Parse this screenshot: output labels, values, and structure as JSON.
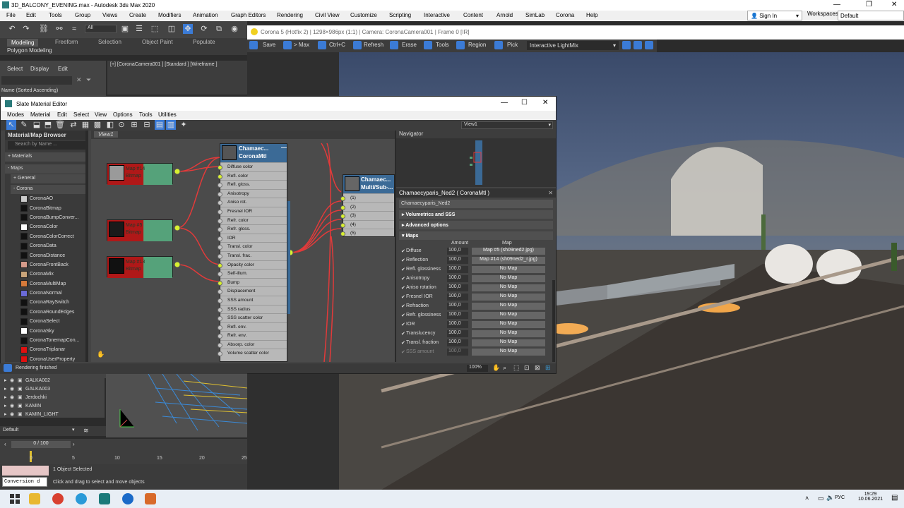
{
  "window": {
    "title": "3D_BALCONY_EVENING.max - Autodesk 3ds Max 2020",
    "signin": "Sign In",
    "workspaces_label": "Workspaces:",
    "workspace_value": "Default"
  },
  "menu": [
    "File",
    "Edit",
    "Tools",
    "Group",
    "Views",
    "Create",
    "Modifiers",
    "Animation",
    "Graph Editors",
    "Rendering",
    "Civil View",
    "Customize",
    "Scripting",
    "Interactive",
    "Content",
    "Arnold",
    "SimLab",
    "Corona",
    "Help"
  ],
  "toolbar": {
    "selection_filter": "All"
  },
  "ribbon": {
    "tabs": [
      "Modeling",
      "Freeform",
      "Selection",
      "Object Paint",
      "Populate"
    ],
    "sub": "Polygon Modeling"
  },
  "scene_explorer": {
    "tabs": [
      "Select",
      "Display",
      "Edit"
    ],
    "sort_label": "Name (Sorted Ascending)"
  },
  "viewport_label": "[+] [CoronaCamera001 ] [Standard ] [Wireframe ]",
  "vfb": {
    "title": "Corona 5 (Hotfix 2) | 1298×986px (1:1) | Camera: CoronaCamera001 | Frame 0 [IR]",
    "buttons": [
      "Save",
      "> Max",
      "Ctrl+C",
      "Refresh",
      "Erase",
      "Tools",
      "Region",
      "Pick"
    ],
    "lightmix": "Interactive LightMix"
  },
  "slate": {
    "title": "Slate Material Editor",
    "menu": [
      "Modes",
      "Material",
      "Edit",
      "Select",
      "View",
      "Options",
      "Tools",
      "Utilities"
    ],
    "view_dropdown": "View1",
    "browser": {
      "header": "Material/Map Browser",
      "search_placeholder": "Search by Name ...",
      "materials": "+ Materials",
      "maps": "- Maps",
      "general": "+ General",
      "corona": "- Corona",
      "items": [
        {
          "name": "CoronaAO",
          "color": "#cccccc"
        },
        {
          "name": "CoronaBitmap",
          "color": "#111111"
        },
        {
          "name": "CoronaBumpConver...",
          "color": "#111111"
        },
        {
          "name": "CoronaColor",
          "color": "#ffffff"
        },
        {
          "name": "CoronaColorCorrect",
          "color": "#111111"
        },
        {
          "name": "CoronaData",
          "color": "#111111"
        },
        {
          "name": "CoronaDistance",
          "color": "#111111"
        },
        {
          "name": "CoronaFrontBack",
          "color": "#d59a8a"
        },
        {
          "name": "CoronaMix",
          "color": "#c9a47a"
        },
        {
          "name": "CoronaMultiMap",
          "color": "#d67a3a"
        },
        {
          "name": "CoronaNormal",
          "color": "#6a6ad8"
        },
        {
          "name": "CoronaRaySwitch",
          "color": "#111111"
        },
        {
          "name": "CoronaRoundEdges",
          "color": "#111111"
        },
        {
          "name": "CoronaSelect",
          "color": "#111111"
        },
        {
          "name": "CoronaSky",
          "color": "#ffffff"
        },
        {
          "name": "CoronaTonemapCon...",
          "color": "#111111"
        },
        {
          "name": "CoronaTriplanar",
          "color": "#e01010"
        },
        {
          "name": "CoronaUserProperty",
          "color": "#e01010"
        }
      ]
    },
    "view_tab": "View1",
    "bitmap_nodes": [
      {
        "id": "Map #14",
        "type": "Bitmap"
      },
      {
        "id": "Map #5",
        "type": "Bitmap"
      },
      {
        "id": "Map #13",
        "type": "Bitmap"
      }
    ],
    "mtl_node": {
      "name": "Chamaec...",
      "type": "CoronaMtl",
      "slots": [
        {
          "label": "Diffuse color",
          "on": true
        },
        {
          "label": "Refl. color",
          "on": true
        },
        {
          "label": "Refl. gloss.",
          "on": false
        },
        {
          "label": "Anisotropy",
          "on": false
        },
        {
          "label": "Aniso rot.",
          "on": false
        },
        {
          "label": "Fresnel IOR",
          "on": false
        },
        {
          "label": "Refr. color",
          "on": false
        },
        {
          "label": "Refr. gloss.",
          "on": false
        },
        {
          "label": "IOR",
          "on": false
        },
        {
          "label": "Transl. color",
          "on": false
        },
        {
          "label": "Transl. frac.",
          "on": false
        },
        {
          "label": "Opacity color",
          "on": true
        },
        {
          "label": "Self-illum.",
          "on": false
        },
        {
          "label": "Bump",
          "on": true
        },
        {
          "label": "Displacement",
          "on": false
        },
        {
          "label": "SSS amount",
          "on": false
        },
        {
          "label": "SSS radius",
          "on": false
        },
        {
          "label": "SSS scatter color",
          "on": false
        },
        {
          "label": "Refl. env.",
          "on": false
        },
        {
          "label": "Refr. env.",
          "on": false
        },
        {
          "label": "Absorp. color",
          "on": false
        },
        {
          "label": "Volume scatter color",
          "on": false
        }
      ]
    },
    "multi_node": {
      "name": "Chamaec...",
      "type": "Multi/Sub-...",
      "slots": [
        "(1)",
        "(2)",
        "(3)",
        "(4)",
        "(5)"
      ]
    },
    "navigator_title": "Navigator",
    "params": {
      "header": "Chamaecyparis_Ned2  ( CoronaMtl )",
      "name_field": "Chamaecyparis_Ned2",
      "rollouts": [
        "Volumetrics and SSS",
        "Advanced options",
        "Maps"
      ],
      "col_amount": "Amount",
      "col_map": "Map",
      "rows": [
        {
          "label": "Diffuse",
          "amount": "100,0",
          "map": "Map #5 (sh09ned2.jpg)"
        },
        {
          "label": "Reflection",
          "amount": "100,0",
          "map": "Map #14 (sh09ned2_r.jpg)"
        },
        {
          "label": "Refl. glossiness",
          "amount": "100,0",
          "map": "No Map"
        },
        {
          "label": "Anisotropy",
          "amount": "100,0",
          "map": "No Map"
        },
        {
          "label": "Aniso rotation",
          "amount": "100,0",
          "map": "No Map"
        },
        {
          "label": "Fresnel IOR",
          "amount": "100,0",
          "map": "No Map"
        },
        {
          "label": "Refraction",
          "amount": "100,0",
          "map": "No Map"
        },
        {
          "label": "Refr. glossiness",
          "amount": "100,0",
          "map": "No Map"
        },
        {
          "label": "IOR",
          "amount": "100,0",
          "map": "No Map"
        },
        {
          "label": "Translucency",
          "amount": "100,0",
          "map": "No Map"
        },
        {
          "label": "Transl. fraction",
          "amount": "100,0",
          "map": "No Map"
        },
        {
          "label": "SSS amount",
          "amount": "100,0",
          "map": "No Map"
        }
      ]
    },
    "zoom": "100%"
  },
  "render_status": "Rendering finished",
  "layers": [
    "GALKA002",
    "GALKA003",
    "Jerdochki",
    "KAMIN",
    "KAMIN_LIGHT"
  ],
  "default_layer": "Default",
  "timeline": {
    "frame": "0 / 100",
    "ticks": [
      "0",
      "5",
      "10",
      "15",
      "20",
      "25"
    ]
  },
  "status": {
    "selected": "1 Object Selected",
    "hint": "Click and drag to select and move objects",
    "script_box": "Conversion d"
  },
  "taskbar": {
    "lang": "РУС",
    "time": "19:29",
    "date": "10.06.2021"
  }
}
